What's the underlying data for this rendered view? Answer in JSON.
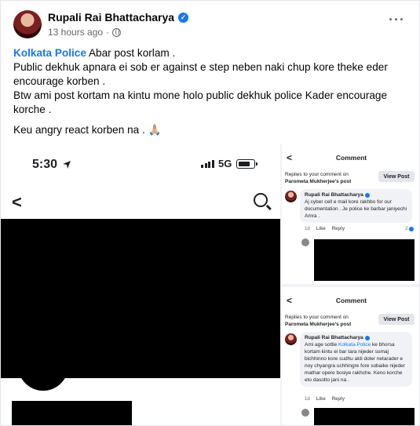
{
  "post": {
    "author": "Rupali Rai Bhattacharya",
    "time": "13 hours ago",
    "separator": "·",
    "more_label": "···",
    "tag": "Kolkata Police",
    "line1_rest": " Abar post korlam .",
    "line2": "Public dekhuk apnara ei sob er against e step neben naki chup kore theke eder encourage korben .",
    "line3": "Btw ami post kortam na kintu mone holo public dekhuk police Kader encourage korche .",
    "line4": "Keu angry react korben na . 🙏🏼"
  },
  "phone": {
    "time": "5:30",
    "network": "5G",
    "back_glyph": "<",
    "icons": {
      "search": "search-icon",
      "location": "location-arrow-icon",
      "signal": "signal-icon",
      "battery": "battery-icon"
    }
  },
  "comment1": {
    "title": "Comment",
    "back_glyph": "<",
    "reply_prefix": "Replies to your comment on",
    "reply_post": "Parometa Mukherjee's post",
    "view_post": "View Post",
    "name": "Rupali Rai Bhattacharya",
    "text": "Aj cyber cell e mail kore rakhbo for our documentation . Je police ke barbar janiyechi Amra .",
    "age": "1d",
    "like": "Like",
    "reply": "Reply",
    "reactions": "2"
  },
  "comment2": {
    "title": "Comment",
    "back_glyph": "<",
    "reply_prefix": "Replies to your comment on",
    "reply_post": "Parometa Mukherjee's post",
    "view_post": "View Post",
    "name": "Rupali Rai Bhattacharya",
    "text_before": "Ami age sottie ",
    "tag": "Kolkata Police",
    "text_after": " ke bhorsa kortam kintu ei bar tara nijeder somaj bichhinno kore sudhu akti doler netarader e noy chyangra uchhingre fore sobaike nijeder mathar opere bosiye rakhche. Keno korche eto dasotto jani na .",
    "age": "1d",
    "like": "Like",
    "reply": "Reply"
  },
  "colors": {
    "accent": "#1877f2",
    "text": "#050505",
    "muted": "#65676b"
  }
}
